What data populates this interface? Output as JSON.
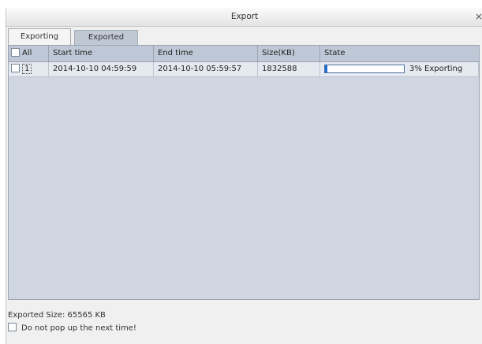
{
  "window": {
    "title": "Export",
    "close_symbol": "×"
  },
  "tabs": [
    {
      "label": "Exporting",
      "active": true
    },
    {
      "label": "Exported",
      "active": false
    }
  ],
  "table": {
    "headers": {
      "select_all": "All",
      "start_time": "Start time",
      "end_time": "End time",
      "size": "Size(KB)",
      "state": "State"
    },
    "rows": [
      {
        "index": "1",
        "start_time": "2014-10-10 04:59:59",
        "end_time": "2014-10-10 05:59:57",
        "size": "1832588",
        "progress_percent": 3,
        "state_text": "3% Exporting"
      }
    ]
  },
  "footer": {
    "exported_size": "Exported Size: 65565 KB",
    "dont_popup_label": "Do not pop up the next time!"
  }
}
